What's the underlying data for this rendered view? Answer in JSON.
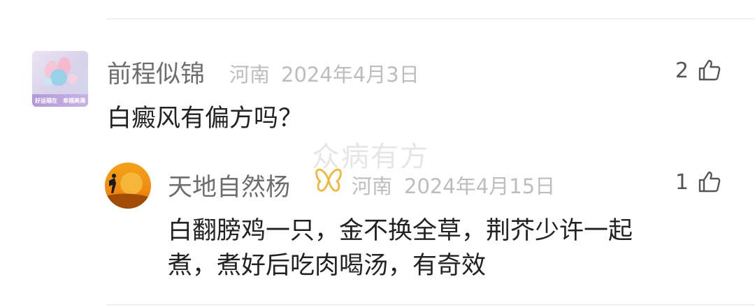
{
  "comment": {
    "user_name": "前程似锦",
    "location": "河南",
    "date": "2024年4月3日",
    "text": "白癜风有偏方吗？",
    "likes": "2",
    "avatar_caption_left": "好运福在",
    "avatar_caption_right": "幸福美满"
  },
  "reply": {
    "user_name": "天地自然杨",
    "location": "河南",
    "date": "2024年4月15日",
    "text_line1": "白翻膀鸡一只，金不换全草，荆芥少许一起",
    "text_line2": "煮，煮好后吃肉喝汤，有奇效",
    "likes": "1"
  },
  "watermark": "众病有方",
  "icons": {
    "like": "thumbs-up-icon",
    "badge": "butterfly-badge-icon"
  },
  "colors": {
    "name": "#6e6e6e",
    "meta": "#bdbdbd",
    "text": "#222222",
    "badge": "#f0b83a"
  }
}
